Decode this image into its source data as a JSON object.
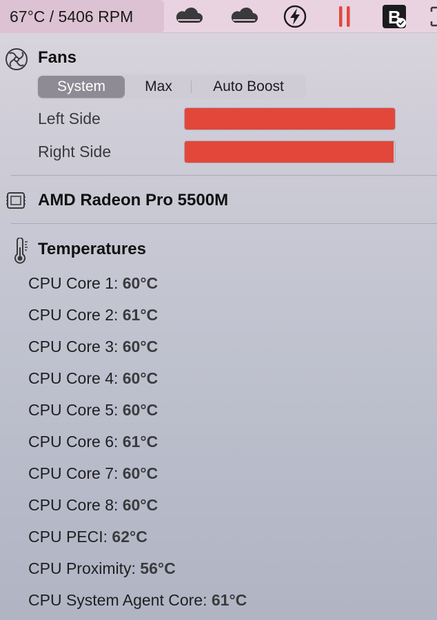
{
  "menubar": {
    "readout": "67°C / 5406 RPM",
    "icons": [
      "cloud-icon",
      "cloud-icon",
      "lightning-icon",
      "pause-icon",
      "b-app-icon",
      "screenshot-icon"
    ]
  },
  "fans": {
    "title": "Fans",
    "modes": [
      "System",
      "Max",
      "Auto Boost"
    ],
    "selected_mode": "System",
    "items": [
      {
        "label": "Left Side",
        "fill_fraction": 1.0
      },
      {
        "label": "Right Side",
        "fill_fraction": 0.995
      }
    ],
    "bar_color": "#e2473a"
  },
  "gpu": {
    "title": "AMD Radeon Pro 5500M"
  },
  "temperatures": {
    "title": "Temperatures",
    "items": [
      {
        "label": "CPU Core 1:",
        "value": "60°C"
      },
      {
        "label": "CPU Core 2:",
        "value": "61°C"
      },
      {
        "label": "CPU Core 3:",
        "value": "60°C"
      },
      {
        "label": "CPU Core 4:",
        "value": "60°C"
      },
      {
        "label": "CPU Core 5:",
        "value": "60°C"
      },
      {
        "label": "CPU Core 6:",
        "value": "61°C"
      },
      {
        "label": "CPU Core 7:",
        "value": "60°C"
      },
      {
        "label": "CPU Core 8:",
        "value": "60°C"
      },
      {
        "label": "CPU PECI:",
        "value": "62°C"
      },
      {
        "label": "CPU Proximity:",
        "value": "56°C"
      },
      {
        "label": "CPU System Agent Core:",
        "value": "61°C"
      }
    ]
  }
}
